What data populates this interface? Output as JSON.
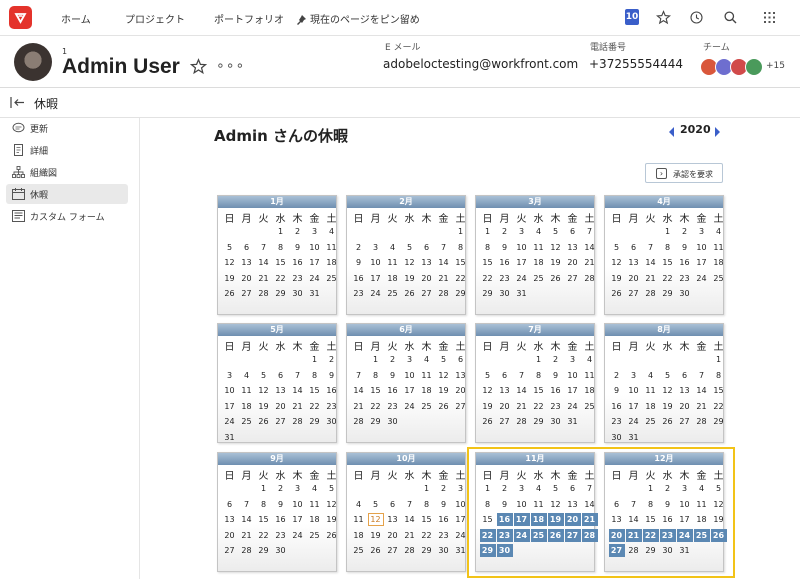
{
  "nav": {
    "home": "ホーム",
    "projects": "プロジェクト",
    "portfolio": "ポートフォリオ",
    "pin": "現在のページをピン留め",
    "notifications": "10",
    "icons": [
      "star-icon",
      "history-icon",
      "search-icon",
      "apps-grid-icon"
    ]
  },
  "user": {
    "id_label": "1",
    "name": "Admin User",
    "email_label": "E メール",
    "email": "adobeloctesting@workfront.com",
    "phone_label": "電話番号",
    "phone": "+37255554444",
    "team_label": "チーム",
    "team_more": "+15",
    "team_colors": [
      "#d9573b",
      "#6e6ecf",
      "#d14a4a",
      "#4a9a5b"
    ]
  },
  "page": {
    "title": "休暇"
  },
  "sidebar": {
    "items": [
      {
        "label": "更新",
        "icon": "comment-icon"
      },
      {
        "label": "詳細",
        "icon": "details-icon"
      },
      {
        "label": "組織図",
        "icon": "org-chart-icon"
      },
      {
        "label": "休暇",
        "icon": "calendar-icon"
      },
      {
        "label": "カスタム フォーム",
        "icon": "form-icon"
      }
    ],
    "active": 3
  },
  "main": {
    "heading": "Admin さんの休暇",
    "year": "2020",
    "request_button": "承認を要求",
    "weekdays": [
      "日",
      "月",
      "火",
      "水",
      "木",
      "金",
      "土"
    ],
    "months": [
      {
        "name": "1月",
        "start": 3,
        "days": 31
      },
      {
        "name": "2月",
        "start": 6,
        "days": 29
      },
      {
        "name": "3月",
        "start": 0,
        "days": 31
      },
      {
        "name": "4月",
        "start": 3,
        "days": 30
      },
      {
        "name": "5月",
        "start": 5,
        "days": 31
      },
      {
        "name": "6月",
        "start": 1,
        "days": 30
      },
      {
        "name": "7月",
        "start": 3,
        "days": 31
      },
      {
        "name": "8月",
        "start": 6,
        "days": 31
      },
      {
        "name": "9月",
        "start": 2,
        "days": 30
      },
      {
        "name": "10月",
        "start": 4,
        "days": 31
      },
      {
        "name": "11月",
        "start": 0,
        "days": 30
      },
      {
        "name": "12月",
        "start": 2,
        "days": 31
      }
    ],
    "time_off": {
      "11月": [
        16,
        17,
        18,
        19,
        20,
        21,
        22,
        23,
        24,
        25,
        26,
        27,
        28,
        29,
        30
      ],
      "12月": [
        20,
        21,
        22,
        23,
        24,
        25,
        26,
        27
      ]
    },
    "today": {
      "month": "10月",
      "day": 12
    }
  }
}
